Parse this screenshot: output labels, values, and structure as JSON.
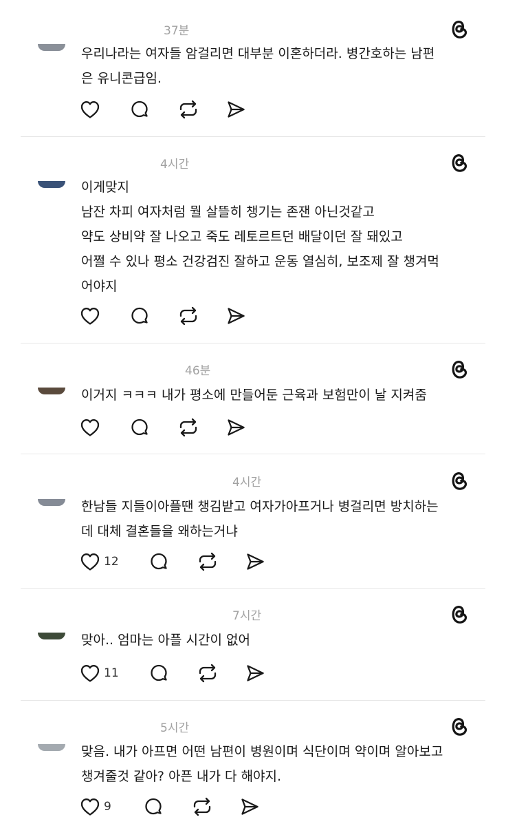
{
  "posts": [
    {
      "time": "37분",
      "avatar_color": "#8a9099",
      "lines": [
        "우리나라는 여자들 암걸리면 대부분 이혼하더라. 병간호하는 남편",
        "은 유니콘급임."
      ],
      "likes": ""
    },
    {
      "time": "4시간",
      "avatar_color": "#3a5278",
      "lines": [
        "이게맞지",
        "남잔 차피 여자처럼 뭘 살뜰히 챙기는 존잰 아닌것같고",
        "약도 상비약 잘 나오고 죽도 레토르트던 배달이던 잘 돼있고",
        "어쩔 수 있나 평소 건강검진 잘하고 운동 열심히, 보조제 잘 챙겨먹",
        "어야지"
      ],
      "likes": ""
    },
    {
      "time": "46분",
      "avatar_color": "#5a4a3c",
      "lines": [
        "이거지 ㅋㅋㅋ 내가 평소에 만들어둔 근육과 보험만이 날 지켜줌"
      ],
      "likes": ""
    },
    {
      "time": "4시간",
      "avatar_color": "#858b96",
      "lines": [
        "한남들 지들이아플땐 챙김받고 여자가아프거나 병걸리면 방치하는",
        "데 대체 결혼들을 왜하는거냐"
      ],
      "likes": "12"
    },
    {
      "time": "7시간",
      "avatar_color": "#3d4a38",
      "lines": [
        "맞아.. 엄마는 아플 시간이 없어"
      ],
      "likes": "11"
    },
    {
      "time": "5시간",
      "avatar_color": "#a4aab0",
      "lines": [
        "맞음. 내가 아프면 어떤 남편이 병원이며 식단이며 약이며 알아보고",
        "챙겨줄것 같아? 아픈 내가 다 해야지."
      ],
      "likes": "9"
    }
  ]
}
